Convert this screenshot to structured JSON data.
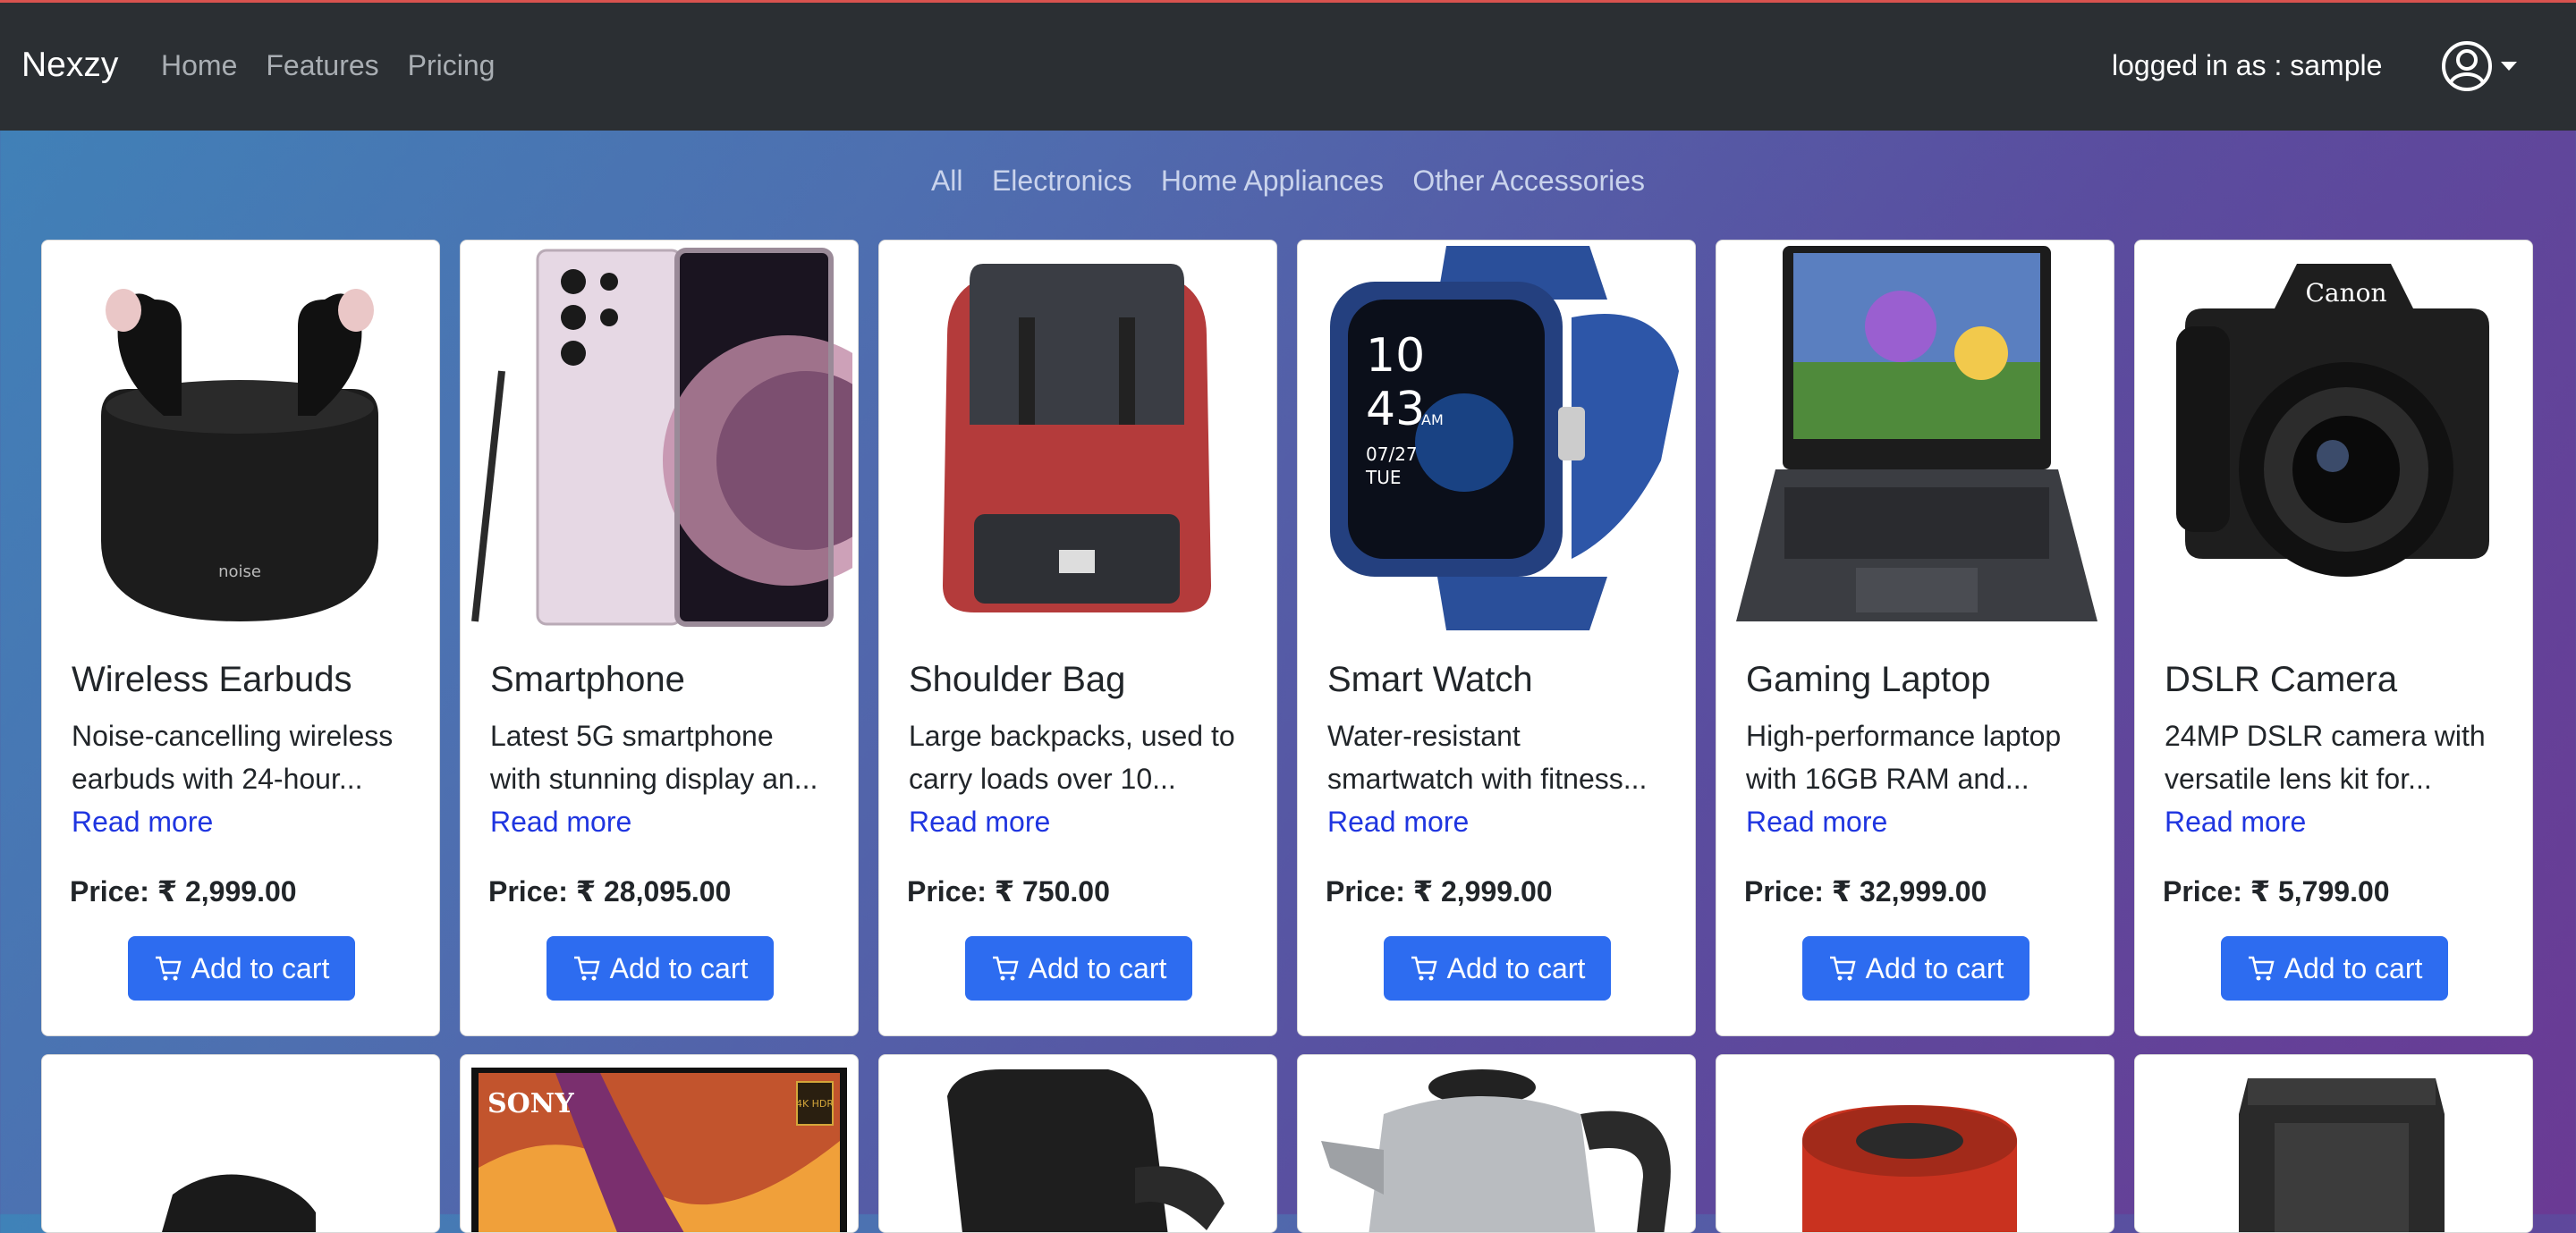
{
  "navbar": {
    "brand": "Nexzy",
    "links": [
      "Home",
      "Features",
      "Pricing"
    ],
    "user_text": "logged in as : sample",
    "user_icon": "user-circle-icon"
  },
  "filters": [
    "All",
    "Electronics",
    "Home Appliances",
    "Other Accessories"
  ],
  "products": [
    {
      "title": "Wireless Earbuds",
      "desc_line1": "Noise-cancelling wireless",
      "desc_line2": "earbuds with 24-hour...",
      "read_more": "Read more",
      "price": "Price: ₹ 2,999.00",
      "button": "Add to cart",
      "image": "earbuds"
    },
    {
      "title": "Smartphone",
      "desc_line1": "Latest 5G smartphone",
      "desc_line2": "with stunning display an...",
      "read_more": "Read more",
      "price": "Price: ₹ 28,095.00",
      "button": "Add to cart",
      "image": "smartphone"
    },
    {
      "title": "Shoulder Bag",
      "desc_line1": "Large backpacks, used to",
      "desc_line2": "carry loads over 10...",
      "read_more": "Read more",
      "price": "Price: ₹ 750.00",
      "button": "Add to cart",
      "image": "backpack"
    },
    {
      "title": "Smart Watch",
      "desc_line1": "Water-resistant",
      "desc_line2": "smartwatch with fitness...",
      "read_more": "Read more",
      "price": "Price: ₹ 2,999.00",
      "button": "Add to cart",
      "image": "smartwatch"
    },
    {
      "title": "Gaming Laptop",
      "desc_line1": "High-performance laptop",
      "desc_line2": "with 16GB RAM and...",
      "read_more": "Read more",
      "price": "Price: ₹ 32,999.00",
      "button": "Add to cart",
      "image": "laptop"
    },
    {
      "title": "DSLR Camera",
      "desc_line1": "24MP DSLR camera with",
      "desc_line2": "versatile lens kit for...",
      "read_more": "Read more",
      "price": "Price: ₹ 5,799.00",
      "button": "Add to cart",
      "image": "camera"
    }
  ],
  "image_text": {
    "earbuds_brand": "noise",
    "watch_hour": "10",
    "watch_min": "43",
    "watch_ampm": "AM",
    "watch_date": "07/27",
    "watch_day": "TUE",
    "camera_brand": "Canon",
    "tv_brand": "SONY",
    "tv_badge": "4K HDR"
  },
  "colors": {
    "navbar_bg": "#2b2f33",
    "button_bg": "#2d6cf0",
    "link": "#1f35e0"
  }
}
